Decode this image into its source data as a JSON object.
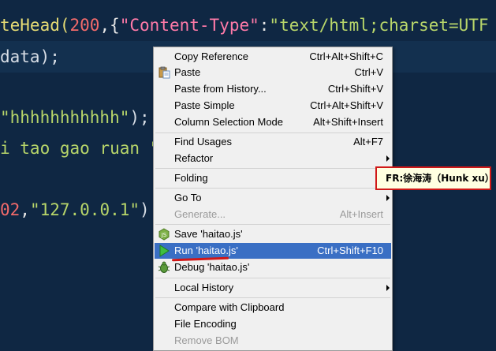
{
  "editor": {
    "lines": [
      {
        "tokens": [
          {
            "t": "teHead(",
            "c": "tok-kw"
          },
          {
            "t": "200",
            "c": "tok-num"
          },
          {
            "t": ",{",
            "c": "tok-pun"
          },
          {
            "t": "\"Content-Type\"",
            "c": "tok-pink"
          },
          {
            "t": ":",
            "c": "tok-pun"
          },
          {
            "t": "\"text/html;charset=UTF",
            "c": "tok-str"
          }
        ]
      },
      {
        "tokens": [
          {
            "t": "data);",
            "c": "tok-plain"
          }
        ]
      },
      {
        "tokens": [
          {
            "t": "\"hhhhhhhhhhh\"",
            "c": "tok-str"
          },
          {
            "t": ");",
            "c": "tok-plain"
          }
        ]
      },
      {
        "tokens": [
          {
            "t": "i tao gao ruan \"",
            "c": "tok-str"
          }
        ]
      },
      {
        "tokens": [
          {
            "t": "02",
            "c": "tok-num"
          },
          {
            "t": ",",
            "c": "tok-pun"
          },
          {
            "t": "\"127.0.0.1\"",
            "c": "tok-str"
          },
          {
            "t": ")",
            "c": "tok-plain"
          }
        ]
      }
    ]
  },
  "context_menu": {
    "items": [
      {
        "label": "Copy Reference",
        "shortcut": "Ctrl+Alt+Shift+C"
      },
      {
        "label": "Paste",
        "shortcut": "Ctrl+V",
        "icon": "clipboard-icon"
      },
      {
        "label": "Paste from History...",
        "shortcut": "Ctrl+Shift+V"
      },
      {
        "label": "Paste Simple",
        "shortcut": "Ctrl+Alt+Shift+V"
      },
      {
        "label": "Column Selection Mode",
        "shortcut": "Alt+Shift+Insert"
      },
      {
        "label": "Find Usages",
        "shortcut": "Alt+F7"
      },
      {
        "label": "Refactor",
        "submenu": true
      },
      {
        "label": "Folding",
        "submenu": true
      },
      {
        "label": "Go To",
        "submenu": true
      },
      {
        "label": "Generate...",
        "shortcut": "Alt+Insert",
        "disabled": true
      },
      {
        "label": "Save 'haitao.js'",
        "icon": "nodejs-icon"
      },
      {
        "label": "Run 'haitao.js'",
        "shortcut": "Ctrl+Shift+F10",
        "icon": "run-icon",
        "selected": true
      },
      {
        "label": "Debug 'haitao.js'",
        "icon": "debug-icon"
      },
      {
        "label": "Local History",
        "submenu": true
      },
      {
        "label": "Compare with Clipboard"
      },
      {
        "label": "File Encoding"
      },
      {
        "label": "Remove BOM",
        "disabled": true
      }
    ]
  },
  "tooltip": {
    "text": "FR:徐海涛（Hunk xu）"
  },
  "colors": {
    "editor_bg": "#0f2743",
    "selection": "#3a6fc4",
    "highlight_border": "#d01818",
    "menu_bg": "#f0f0f0"
  }
}
